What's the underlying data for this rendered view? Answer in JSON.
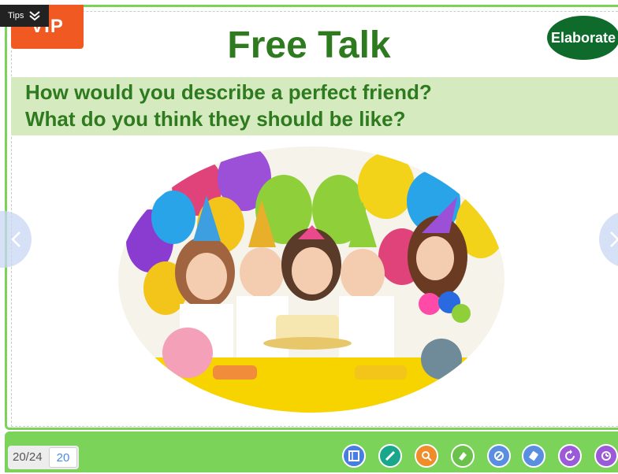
{
  "header": {
    "tips_label": "Tips",
    "logo_text": "VIP KID",
    "title": "Free Talk",
    "badge": "Elaborate"
  },
  "questions": [
    "How would you describe a perfect friend?",
    "What do you think they should be like?"
  ],
  "pagination": {
    "label": "20/24",
    "current": "20"
  },
  "toolbar": {
    "tools": [
      {
        "name": "board-icon",
        "color": "#4a7de0"
      },
      {
        "name": "pen-icon",
        "color": "#1aa68a"
      },
      {
        "name": "magnifier-icon",
        "color": "#f08c2a"
      },
      {
        "name": "eraser-icon",
        "color": "#6ac24a"
      },
      {
        "name": "palette-icon",
        "color": "#5a8ee0"
      },
      {
        "name": "clear-icon",
        "color": "#5a8ee0"
      },
      {
        "name": "refresh-icon",
        "color": "#9b5ad8"
      },
      {
        "name": "timer-icon",
        "color": "#9b5ad8"
      }
    ]
  },
  "colors": {
    "frame_green": "#7cd35a",
    "title_green": "#2e7a1e",
    "band_green": "#d6eac0",
    "logo_orange": "#f05a22",
    "badge_green": "#0f6b2b"
  }
}
